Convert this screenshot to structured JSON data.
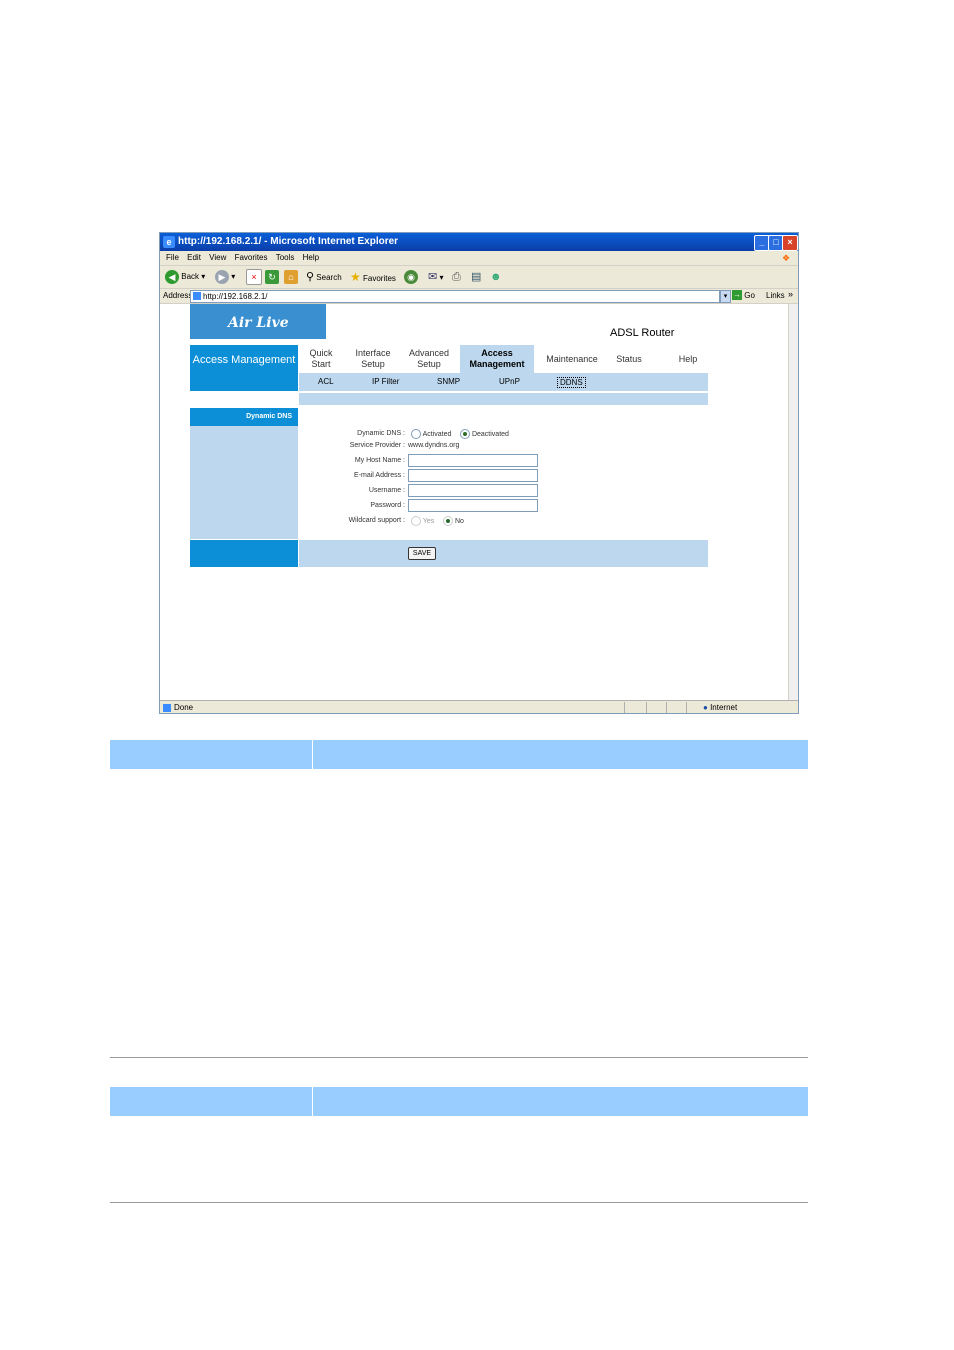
{
  "browser": {
    "window_title": "http://192.168.2.1/ - Microsoft Internet Explorer",
    "menu": [
      "File",
      "Edit",
      "View",
      "Favorites",
      "Tools",
      "Help"
    ],
    "toolbar": {
      "back": "Back",
      "search": "Search",
      "favorites": "Favorites"
    },
    "address_label": "Address",
    "address_value": "http://192.168.2.1/",
    "go": "Go",
    "links": "Links",
    "status_text": "Done",
    "zone": "Internet"
  },
  "router": {
    "brand": "Air Live",
    "product": "ADSL Router",
    "section": "Access Management",
    "nav": [
      {
        "l1": "Quick",
        "l2": "Start"
      },
      {
        "l1": "Interface",
        "l2": "Setup"
      },
      {
        "l1": "Advanced",
        "l2": "Setup"
      },
      {
        "l1": "Access",
        "l2": "Management"
      },
      {
        "l1": "Maintenance",
        "l2": ""
      },
      {
        "l1": "Status",
        "l2": ""
      },
      {
        "l1": "Help",
        "l2": ""
      }
    ],
    "subnav": [
      "ACL",
      "IP Filter",
      "SNMP",
      "UPnP",
      "DDNS"
    ],
    "panel_title": "Dynamic DNS",
    "form": {
      "ddns_label": "Dynamic DNS :",
      "activated": "Activated",
      "deactivated": "Deactivated",
      "provider_label": "Service Provider :",
      "provider_value": "www.dyndns.org",
      "host_label": "My Host Name :",
      "email_label": "E-mail Address :",
      "username_label": "Username :",
      "password_label": "Password :",
      "wildcard_label": "Wildcard support :",
      "yes": "Yes",
      "no": "No",
      "save": "SAVE"
    }
  }
}
